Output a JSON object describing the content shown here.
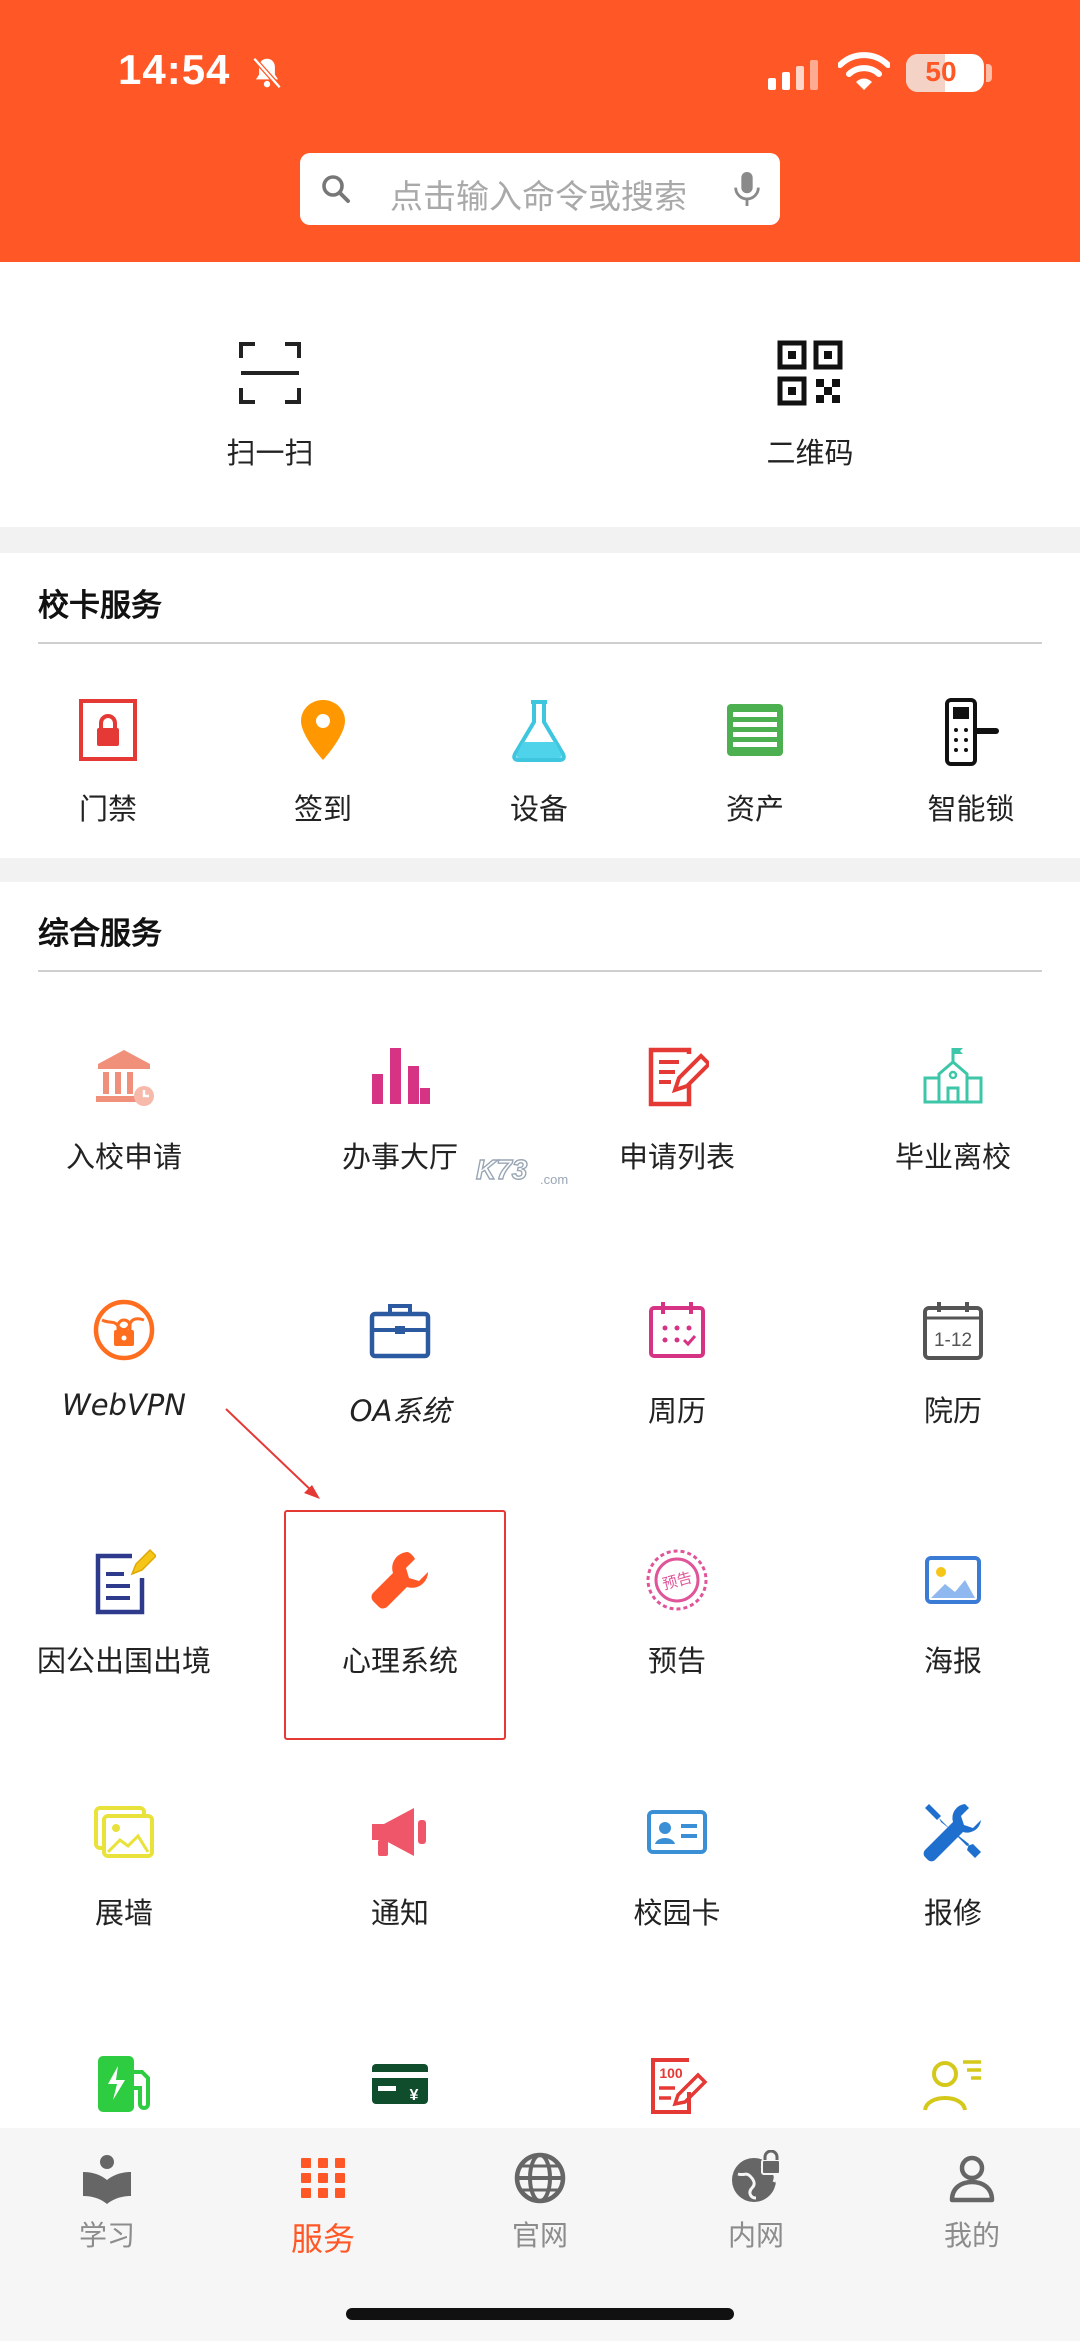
{
  "status_bar": {
    "time": "14:54",
    "battery": "50",
    "battery_level": 0.5
  },
  "search": {
    "placeholder": "点击输入命令或搜索"
  },
  "quick_actions": [
    {
      "label": "扫一扫",
      "icon": "scan-icon"
    },
    {
      "label": "二维码",
      "icon": "qr-code-icon"
    }
  ],
  "card_services": {
    "title": "校卡服务",
    "items": [
      {
        "label": "门禁",
        "icon": "door-lock-icon"
      },
      {
        "label": "签到",
        "icon": "location-pin-icon"
      },
      {
        "label": "设备",
        "icon": "flask-icon"
      },
      {
        "label": "资产",
        "icon": "list-icon"
      },
      {
        "label": "智能锁",
        "icon": "smart-lock-icon"
      }
    ]
  },
  "general_services": {
    "title": "综合服务",
    "items": [
      {
        "label": "入校申请",
        "icon": "school-building-icon"
      },
      {
        "label": "办事大厅",
        "icon": "bar-chart-icon"
      },
      {
        "label": "申请列表",
        "icon": "edit-document-icon"
      },
      {
        "label": "毕业离校",
        "icon": "school-icon"
      },
      {
        "label": "WebVPN",
        "icon": "globe-lock-icon"
      },
      {
        "label": "OA系统",
        "icon": "briefcase-icon"
      },
      {
        "label": "周历",
        "icon": "calendar-icon"
      },
      {
        "label": "院历",
        "icon": "calendar-range-icon"
      },
      {
        "label": "因公出国出境",
        "icon": "document-pen-icon"
      },
      {
        "label": "心理系统",
        "icon": "wrench-icon"
      },
      {
        "label": "预告",
        "icon": "stamp-icon"
      },
      {
        "label": "海报",
        "icon": "image-icon"
      },
      {
        "label": "展墙",
        "icon": "gallery-icon"
      },
      {
        "label": "通知",
        "icon": "megaphone-icon"
      },
      {
        "label": "校园卡",
        "icon": "id-card-icon"
      },
      {
        "label": "报修",
        "icon": "tools-icon"
      },
      {
        "label": "",
        "icon": "charging-station-icon"
      },
      {
        "label": "",
        "icon": "payment-card-icon"
      },
      {
        "label": "",
        "icon": "score-sheet-icon"
      },
      {
        "label": "",
        "icon": "teacher-icon"
      }
    ]
  },
  "watermark": {
    "text": "K73",
    "sub": ".com"
  },
  "tabbar": [
    {
      "label": "学习",
      "icon": "book-icon",
      "active": false
    },
    {
      "label": "服务",
      "icon": "grid-icon",
      "active": true
    },
    {
      "label": "官网",
      "icon": "globe-icon",
      "active": false
    },
    {
      "label": "内网",
      "icon": "globe-lock-icon",
      "active": false
    },
    {
      "label": "我的",
      "icon": "user-icon",
      "active": false
    }
  ],
  "colors": {
    "accent": "#ff5725",
    "highlight_box": "#e53935"
  }
}
